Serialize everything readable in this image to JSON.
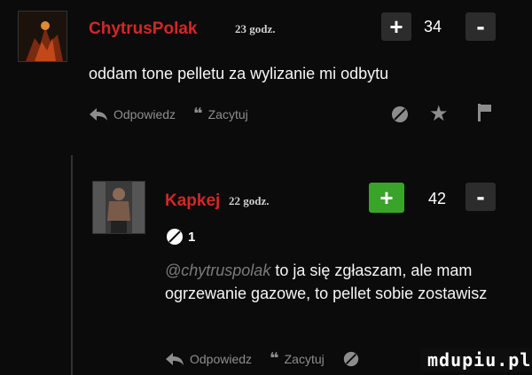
{
  "comment1": {
    "username": "ChytrusPolak",
    "username_color": "#d32727",
    "time": "23 godz.",
    "score": "34",
    "plus_label": "+",
    "minus_label": "-",
    "text": "oddam tone pelletu za wylizanie mi odbytu",
    "actions": {
      "reply": "Odpowiedz",
      "quote": "Zacytuj"
    },
    "icons": [
      "reply-icon",
      "quote-icon",
      "spam-icon",
      "star-icon",
      "flag-icon"
    ]
  },
  "comment2": {
    "username": "Kapkej",
    "username_color": "#d32727",
    "time": "22 godz.",
    "score": "42",
    "plus_label": "+",
    "minus_label": "-",
    "attachment_count": "1",
    "mention": "@chytruspolak",
    "text": "to ja się zgłaszam, ale mam ogrzewanie gazowe, to pellet sobie zostawisz",
    "actions": {
      "reply": "Odpowiedz",
      "quote": "Zacytuj"
    },
    "upvote_color": "#3aa32a"
  },
  "watermark": "mdupiu.pl"
}
